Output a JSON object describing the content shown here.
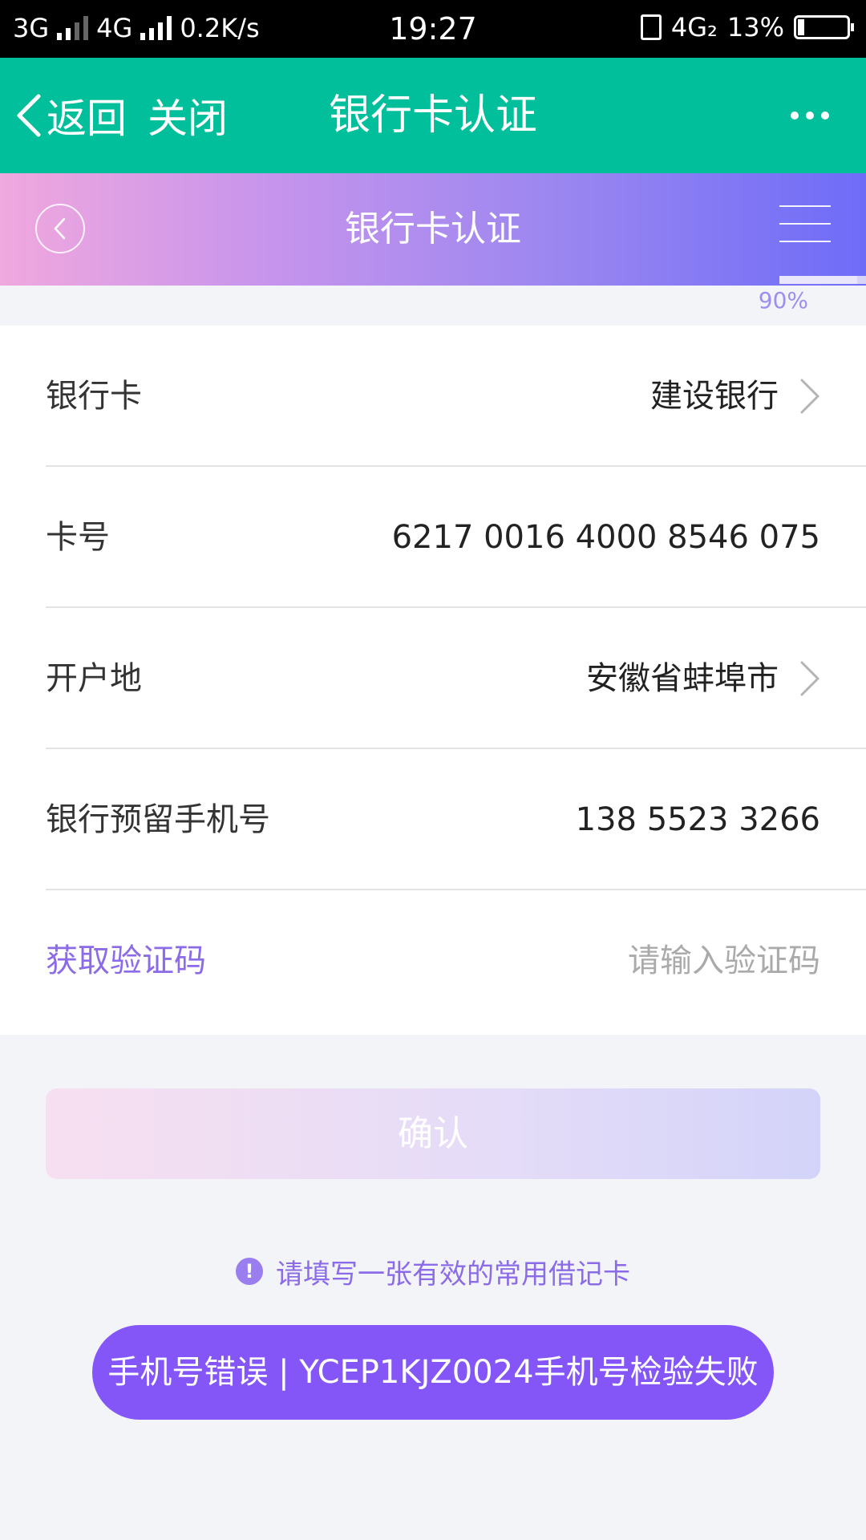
{
  "status_bar": {
    "network_left": "3G",
    "network_mid": "4G",
    "speed": "0.2K/s",
    "time": "19:27",
    "network_right": "4G₂",
    "battery": "13%"
  },
  "app_bar": {
    "back_label": "返回",
    "close_label": "关闭",
    "title": "银行卡认证"
  },
  "header": {
    "title": "银行卡认证",
    "progress_percent": 90,
    "progress_label": "90%"
  },
  "form": {
    "bank_card": {
      "label": "银行卡",
      "value": "建设银行"
    },
    "card_number": {
      "label": "卡号",
      "value": "6217 0016 4000 8546 075"
    },
    "location": {
      "label": "开户地",
      "value": "安徽省蚌埠市"
    },
    "phone": {
      "label": "银行预留手机号",
      "value": "138 5523 3266"
    },
    "verify_code": {
      "action_label": "获取验证码",
      "placeholder": "请输入验证码"
    }
  },
  "confirm_label": "确认",
  "hint_text": "请填写一张有效的常用借记卡",
  "toast_text": "手机号错误 | YCEP1KJZ0024手机号检验失败",
  "colors": {
    "app_bar": "#00bf9a",
    "accent": "#8b6be8",
    "toast": "#8456f8"
  }
}
